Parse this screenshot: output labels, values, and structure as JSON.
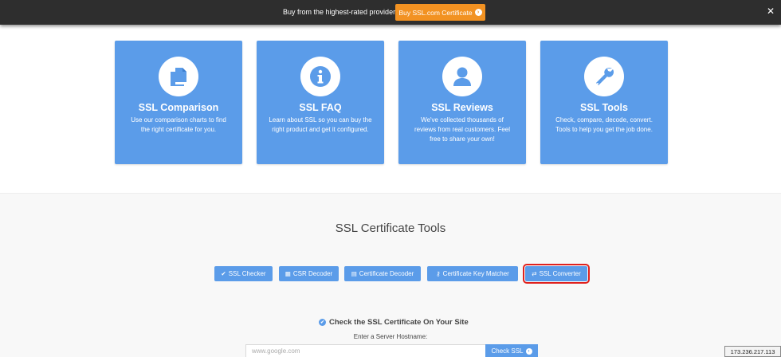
{
  "topbar": {
    "text": "Buy from the highest-rated provider",
    "cta_label": "Buy SSL.com Certificate",
    "close_glyph": "✕",
    "accent": "#f29222"
  },
  "cards": [
    {
      "icon": "copy-icon",
      "title": "SSL Comparison",
      "description": "Use our comparison charts to find the right certificate for you."
    },
    {
      "icon": "info-icon",
      "title": "SSL FAQ",
      "description": "Learn about SSL so you can buy the right product and get it configured."
    },
    {
      "icon": "user-icon",
      "title": "SSL Reviews",
      "description": "We've collected thousands of reviews from real customers. Feel free to share your own!"
    },
    {
      "icon": "wrench-icon",
      "title": "SSL Tools",
      "description": "Check, compare, decode, convert. Tools to help you get the job done."
    }
  ],
  "tools": {
    "title": "SSL Certificate Tools",
    "buttons": [
      {
        "icon": "check-circle-icon",
        "glyph": "✔",
        "label": "SSL Checker"
      },
      {
        "icon": "grid-icon",
        "glyph": "▦",
        "label": "CSR Decoder"
      },
      {
        "icon": "file-icon",
        "glyph": "▤",
        "label": "Certificate Decoder"
      },
      {
        "icon": "key-icon",
        "glyph": "⚷",
        "label": "Certificate Key Matcher"
      },
      {
        "icon": "exchange-icon",
        "glyph": "⇄",
        "label": "SSL Converter",
        "selected": true
      }
    ]
  },
  "checker": {
    "heading": "Check the SSL Certificate On Your Site",
    "label": "Enter a Server Hostname:",
    "placeholder": "www.google.com",
    "button_label": "Check SSL"
  },
  "ip_address": "173.236.217.113",
  "colors": {
    "card_blue": "#5b9ce9",
    "highlight_red": "#e0211d",
    "topbar_bg": "#2e2e2e"
  }
}
